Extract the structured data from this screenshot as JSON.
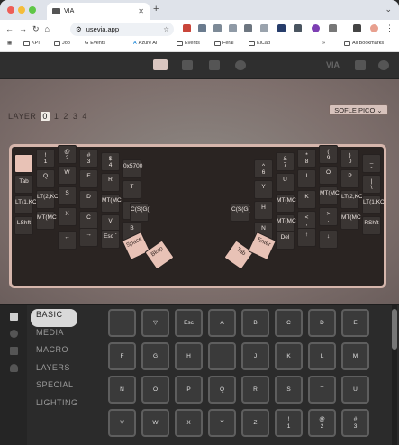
{
  "browser": {
    "tab_title": "VIA",
    "url": "usevia.app",
    "bookmarks": [
      "KPI",
      "Job",
      "Events",
      "Azure AI",
      "Events",
      "Feral",
      "KiCad",
      "All Bookmarks"
    ]
  },
  "app": {
    "layer_label": "LAYER",
    "layers": [
      "0",
      "1",
      "2",
      "3",
      "4"
    ],
    "keyboard_name": "SOFLE PICO ⌄",
    "menu": [
      "BASIC",
      "MEDIA",
      "MACRO",
      "LAYERS",
      "SPECIAL",
      "LIGHTING"
    ],
    "left_keys": [
      {
        "l": "",
        "c": "pink"
      },
      {
        "l": "!\n1",
        "c": ""
      },
      {
        "l": "@\n2",
        "c": ""
      },
      {
        "l": "#\n3",
        "c": ""
      },
      {
        "l": "$\n4",
        "c": ""
      },
      {
        "l": "0x5700",
        "c": ""
      },
      {
        "l": "Tab",
        "c": ""
      },
      {
        "l": "Q",
        "c": ""
      },
      {
        "l": "W",
        "c": ""
      },
      {
        "l": "E",
        "c": ""
      },
      {
        "l": "R",
        "c": ""
      },
      {
        "l": "T",
        "c": ""
      },
      {
        "l": "LT(1,KC",
        "c": ""
      },
      {
        "l": "LT(2,KC",
        "c": ""
      },
      {
        "l": "S",
        "c": ""
      },
      {
        "l": "D",
        "c": ""
      },
      {
        "l": "MT(MC",
        "c": ""
      },
      {
        "l": "G",
        "c": ""
      },
      {
        "l": "LShft",
        "c": ""
      },
      {
        "l": "MT(MC",
        "c": ""
      },
      {
        "l": "X",
        "c": ""
      },
      {
        "l": "C",
        "c": ""
      },
      {
        "l": "V",
        "c": ""
      },
      {
        "l": "B",
        "c": ""
      },
      {
        "l": "←",
        "c": ""
      },
      {
        "l": "→",
        "c": ""
      },
      {
        "l": "Esc `",
        "c": ""
      },
      {
        "l": "C(S(G(",
        "c": ""
      }
    ],
    "right_keys": [
      {
        "l": "^\n6",
        "c": ""
      },
      {
        "l": "&\n7",
        "c": ""
      },
      {
        "l": "*\n8",
        "c": ""
      },
      {
        "l": "(\n9",
        "c": ""
      },
      {
        "l": ")\n0",
        "c": ""
      },
      {
        "l": "_\n-",
        "c": ""
      },
      {
        "l": "Y",
        "c": ""
      },
      {
        "l": "U",
        "c": ""
      },
      {
        "l": "I",
        "c": ""
      },
      {
        "l": "O",
        "c": ""
      },
      {
        "l": "P",
        "c": ""
      },
      {
        "l": "|\n\\",
        "c": ""
      },
      {
        "l": "H",
        "c": ""
      },
      {
        "l": "MT(MC",
        "c": ""
      },
      {
        "l": "K",
        "c": ""
      },
      {
        "l": "MT(MC",
        "c": ""
      },
      {
        "l": "LT(2,KC",
        "c": ""
      },
      {
        "l": "LT(1,KC",
        "c": ""
      },
      {
        "l": "N",
        "c": ""
      },
      {
        "l": "MT(MC",
        "c": ""
      },
      {
        "l": "<\n,",
        "c": ""
      },
      {
        "l": ">\n.",
        "c": ""
      },
      {
        "l": "MT(MC",
        "c": ""
      },
      {
        "l": "RShft",
        "c": ""
      },
      {
        "l": "Del",
        "c": ""
      },
      {
        "l": "↑",
        "c": ""
      },
      {
        "l": "↓",
        "c": ""
      },
      {
        "l": "C(S(G(",
        "c": ""
      }
    ],
    "thumb_keys": [
      "Space",
      "Bksp",
      "Tab",
      "Enter"
    ],
    "picker_keys": [
      "",
      "▽",
      "Esc",
      "A",
      "B",
      "C",
      "D",
      "E",
      "F",
      "G",
      "H",
      "I",
      "J",
      "K",
      "L",
      "M",
      "N",
      "O",
      "P",
      "Q",
      "R",
      "S",
      "T",
      "U",
      "V",
      "W",
      "X",
      "Y",
      "Z",
      "!\n1",
      "@\n2",
      "#\n3"
    ]
  }
}
